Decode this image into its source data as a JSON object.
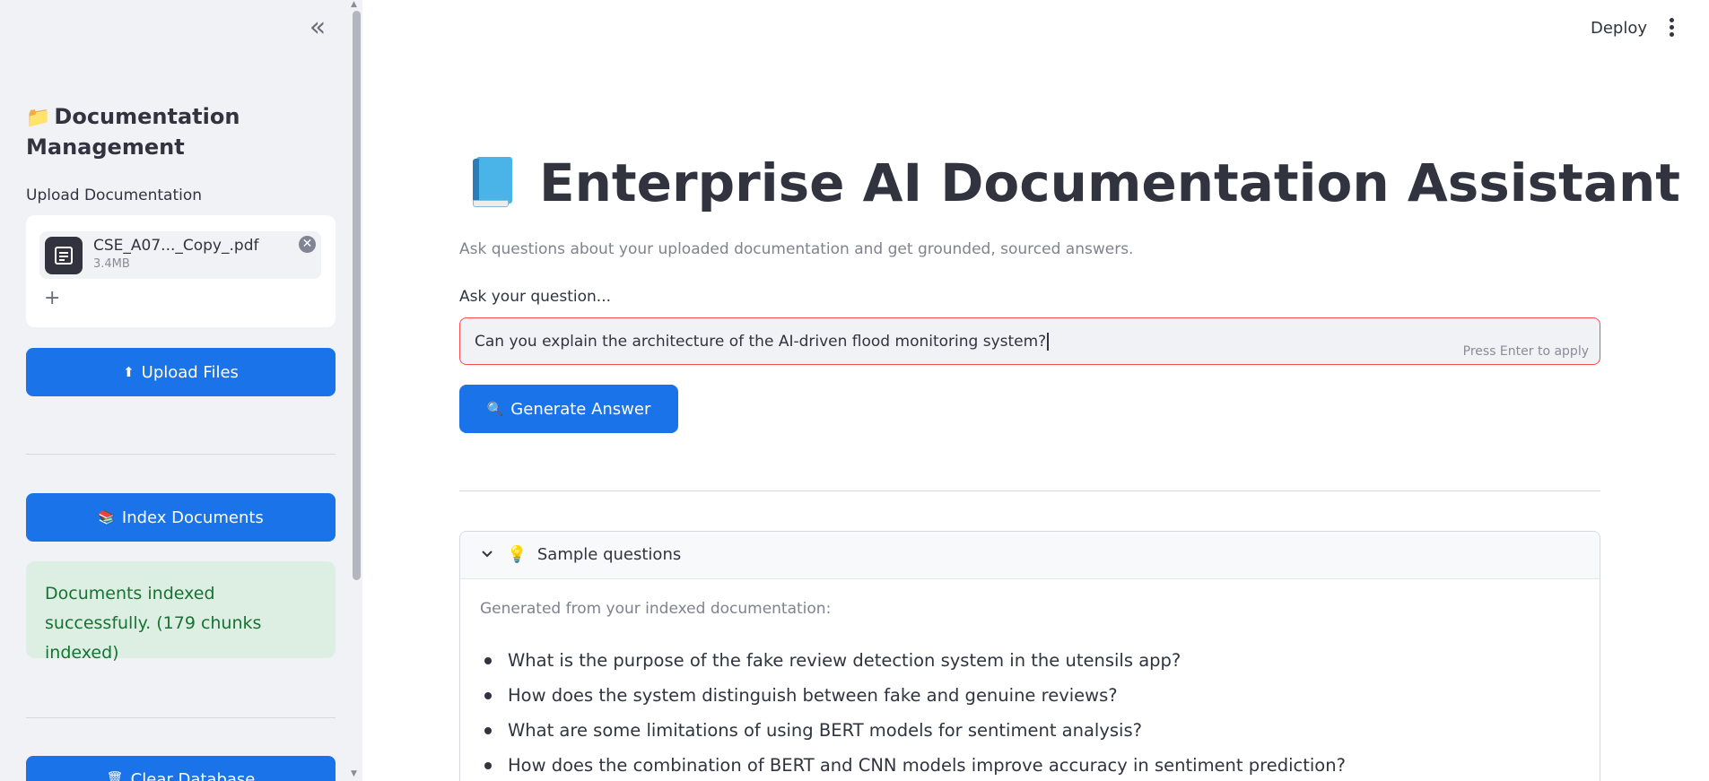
{
  "sidebar": {
    "collapse_glyph": "«",
    "title_emoji": "📁",
    "title": "Documentation Management",
    "upload_label": "Upload Documentation",
    "file": {
      "name": "CSE_A07..._Copy_.pdf",
      "size": "3.4MB",
      "remove_glyph": "✕"
    },
    "add_glyph": "+",
    "upload_button": {
      "icon": "⬆",
      "label": "Upload Files"
    },
    "index_button": {
      "icon": "📚",
      "label": "Index Documents"
    },
    "success_message": "Documents indexed successfully. (179 chunks indexed)",
    "clear_button": {
      "icon": "🗑",
      "label": "Clear Database"
    }
  },
  "header": {
    "deploy_label": "Deploy"
  },
  "main": {
    "title": "Enterprise AI Documentation Assistant",
    "subtitle": "Ask questions about your uploaded documentation and get grounded, sourced answers.",
    "ask_label": "Ask your question...",
    "question_value": "Can you explain the architecture of the AI-driven flood monitoring system?",
    "press_enter_hint": "Press Enter to apply",
    "generate_button": {
      "icon": "🔍",
      "label": "Generate Answer"
    },
    "sample": {
      "icon": "💡",
      "title": "Sample questions",
      "intro": "Generated from your indexed documentation:",
      "questions": [
        "What is the purpose of the fake review detection system in the utensils app?",
        "How does the system distinguish between fake and genuine reviews?",
        "What are some limitations of using BERT models for sentiment analysis?",
        "How does the combination of BERT and CNN models improve accuracy in sentiment prediction?"
      ]
    }
  },
  "colors": {
    "primary": "#1a73e8",
    "sidebar_bg": "#f0f2f6",
    "success_bg": "#dcefe2",
    "success_text": "#177233",
    "input_border": "#ff4b4b"
  }
}
